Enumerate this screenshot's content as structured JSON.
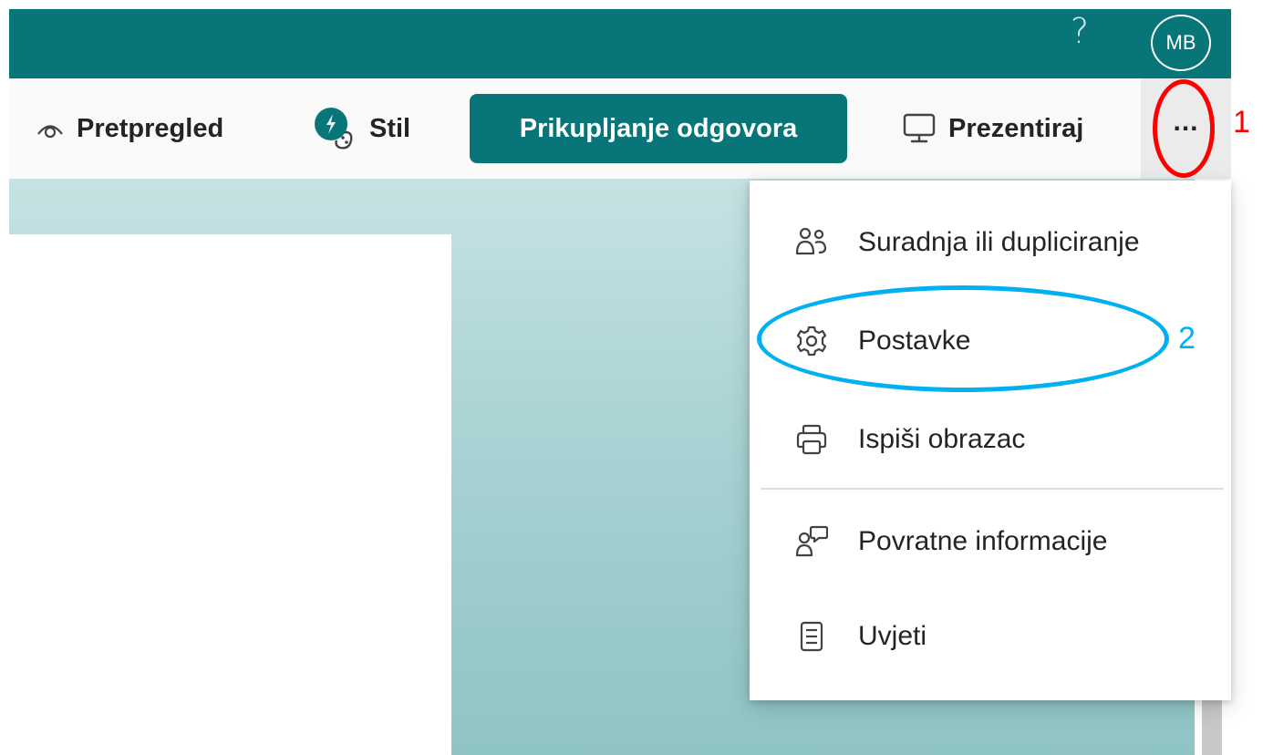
{
  "header": {
    "help_icon": "?",
    "avatar_initials": "MB"
  },
  "toolbar": {
    "preview_label": "Pretpregled",
    "style_label": "Stil",
    "collect_label": "Prikupljanje odgovora",
    "present_label": "Prezentiraj",
    "more_label": "..."
  },
  "menu": {
    "items": [
      {
        "label": "Suradnja ili dupliciranje",
        "icon": "people-icon"
      },
      {
        "label": "Postavke",
        "icon": "gear-icon"
      },
      {
        "label": "Ispiši obrazac",
        "icon": "printer-icon"
      },
      {
        "label": "Povratne informacije",
        "icon": "feedback-icon"
      },
      {
        "label": "Uvjeti",
        "icon": "document-icon"
      }
    ]
  },
  "annotations": {
    "marker_1": "1",
    "marker_2": "2",
    "marker_1_color": "#ff0000",
    "marker_2_color": "#00b0f0"
  },
  "colors": {
    "brand": "#087578",
    "menu_bg": "#ffffff"
  }
}
